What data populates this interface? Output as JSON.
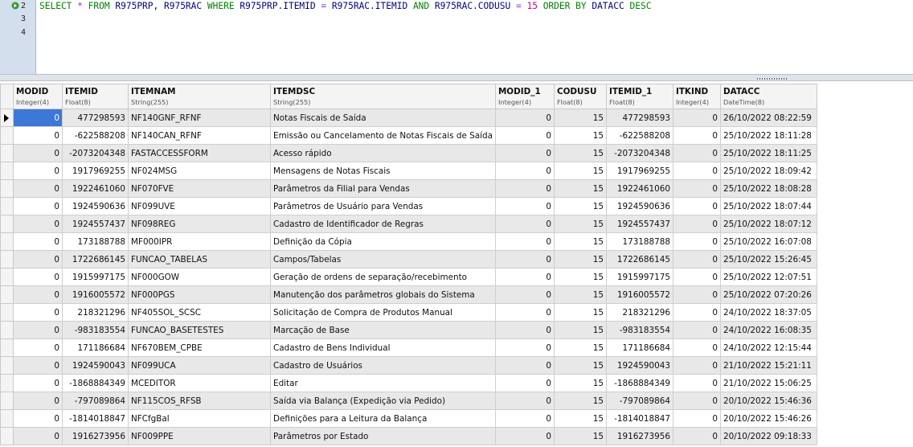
{
  "editor": {
    "line_numbers": [
      "2",
      "3",
      "4"
    ],
    "sql": {
      "kw_select": "SELECT",
      "star": "*",
      "kw_from": "FROM",
      "tables": "R975PRP, R975RAC",
      "kw_where": "WHERE",
      "cond1_left": "R975PRP.ITEMID",
      "eq1": "=",
      "cond1_right": "R975RAC.ITEMID",
      "kw_and": "AND",
      "cond2_left": "R975RAC.CODUSU",
      "eq2": "=",
      "cond2_value": "15",
      "kw_order_by": "ORDER BY",
      "order_col": "DATACC",
      "kw_desc": "DESC"
    }
  },
  "grid": {
    "columns": [
      {
        "name": "MODID",
        "type": "Integer(4)"
      },
      {
        "name": "ITEMID",
        "type": "Float(8)"
      },
      {
        "name": "ITEMNAM",
        "type": "String(255)"
      },
      {
        "name": "ITEMDSC",
        "type": "String(255)"
      },
      {
        "name": "MODID_1",
        "type": "Integer(4)"
      },
      {
        "name": "CODUSU",
        "type": "Float(8)"
      },
      {
        "name": "ITEMID_1",
        "type": "Float(8)"
      },
      {
        "name": "ITKIND",
        "type": "Integer(4)"
      },
      {
        "name": "DATACC",
        "type": "DateTime(8)"
      }
    ],
    "rows": [
      [
        "0",
        "477298593",
        "NF140GNF_RFNF",
        "Notas Fiscais de Saída",
        "0",
        "15",
        "477298593",
        "0",
        "26/10/2022 08:22:59"
      ],
      [
        "0",
        "-622588208",
        "NF140CAN_RFNF",
        "Emissão ou Cancelamento de Notas Fiscais de Saída",
        "0",
        "15",
        "-622588208",
        "0",
        "25/10/2022 18:11:28"
      ],
      [
        "0",
        "-2073204348",
        "FASTACCESSFORM",
        "Acesso rápido",
        "0",
        "15",
        "-2073204348",
        "0",
        "25/10/2022 18:11:25"
      ],
      [
        "0",
        "1917969255",
        "NF024MSG",
        "Mensagens de Notas Fiscais",
        "0",
        "15",
        "1917969255",
        "0",
        "25/10/2022 18:09:42"
      ],
      [
        "0",
        "1922461060",
        "NF070FVE",
        "Parâmetros da Filial para Vendas",
        "0",
        "15",
        "1922461060",
        "0",
        "25/10/2022 18:08:28"
      ],
      [
        "0",
        "1924590636",
        "NF099UVE",
        "Parâmetros de Usuário para Vendas",
        "0",
        "15",
        "1924590636",
        "0",
        "25/10/2022 18:07:44"
      ],
      [
        "0",
        "1924557437",
        "NF098REG",
        "Cadastro de Identificador de Regras",
        "0",
        "15",
        "1924557437",
        "0",
        "25/10/2022 18:07:12"
      ],
      [
        "0",
        "173188788",
        "MF000IPR",
        "Definição da Cópia",
        "0",
        "15",
        "173188788",
        "0",
        "25/10/2022 16:07:08"
      ],
      [
        "0",
        "1722686145",
        "FUNCAO_TABELAS",
        "Campos/Tabelas",
        "0",
        "15",
        "1722686145",
        "0",
        "25/10/2022 15:26:45"
      ],
      [
        "0",
        "1915997175",
        "NF000GOW",
        "Geração de ordens de separação/recebimento",
        "0",
        "15",
        "1915997175",
        "0",
        "25/10/2022 12:07:51"
      ],
      [
        "0",
        "1916005572",
        "NF000PGS",
        "Manutenção dos parâmetros globais do Sistema",
        "0",
        "15",
        "1916005572",
        "0",
        "25/10/2022 07:20:26"
      ],
      [
        "0",
        "218321296",
        "NF405SOL_SCSC",
        "Solicitação de Compra de Produtos Manual",
        "0",
        "15",
        "218321296",
        "0",
        "24/10/2022 18:37:05"
      ],
      [
        "0",
        "-983183554",
        "FUNCAO_BASETESTES",
        "Marcação de Base",
        "0",
        "15",
        "-983183554",
        "0",
        "24/10/2022 16:08:35"
      ],
      [
        "0",
        "171186684",
        "NF670BEM_CPBE",
        "Cadastro de Bens Individual",
        "0",
        "15",
        "171186684",
        "0",
        "24/10/2022 12:15:44"
      ],
      [
        "0",
        "1924590043",
        "NF099UCA",
        "Cadastro de Usuários",
        "0",
        "15",
        "1924590043",
        "0",
        "21/10/2022 15:21:11"
      ],
      [
        "0",
        "-1868884349",
        "MCEDITOR",
        "Editar",
        "0",
        "15",
        "-1868884349",
        "0",
        "21/10/2022 15:06:25"
      ],
      [
        "0",
        "-797089864",
        "NF115COS_RFSB",
        "Saída via Balança (Expedição via Pedido)",
        "0",
        "15",
        "-797089864",
        "0",
        "20/10/2022 15:46:36"
      ],
      [
        "0",
        "-1814018847",
        "NFCfgBal",
        "Definições para a Leitura da Balança",
        "0",
        "15",
        "-1814018847",
        "0",
        "20/10/2022 15:46:26"
      ],
      [
        "0",
        "1916273956",
        "NF009PPE",
        "Parâmetros por Estado",
        "0",
        "15",
        "1916273956",
        "0",
        "20/10/2022 09:18:33"
      ]
    ]
  }
}
